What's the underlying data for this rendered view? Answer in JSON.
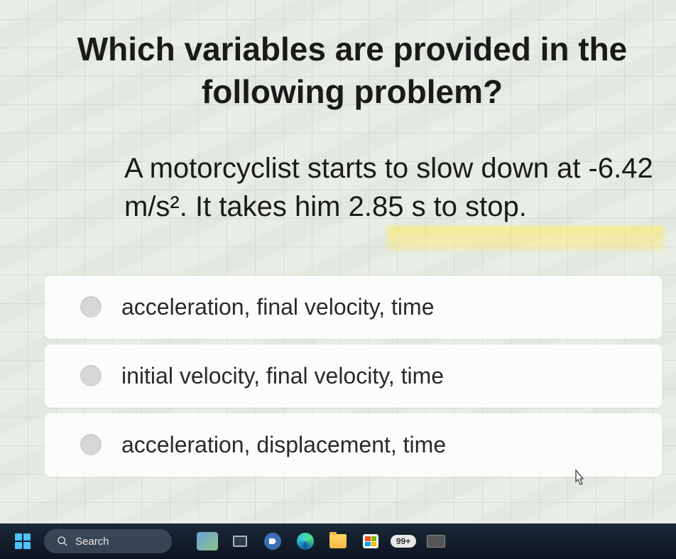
{
  "question": {
    "title": "Which variables are provided in the following problem?",
    "body": "A motorcyclist starts to slow down at -6.42 m/s². It takes him 2.85 s to stop."
  },
  "options": [
    {
      "label": "acceleration, final velocity, time"
    },
    {
      "label": "initial velocity, final velocity, time"
    },
    {
      "label": "acceleration, displacement, time"
    }
  ],
  "taskbar": {
    "search_placeholder": "Search",
    "badge_count": "99+"
  }
}
